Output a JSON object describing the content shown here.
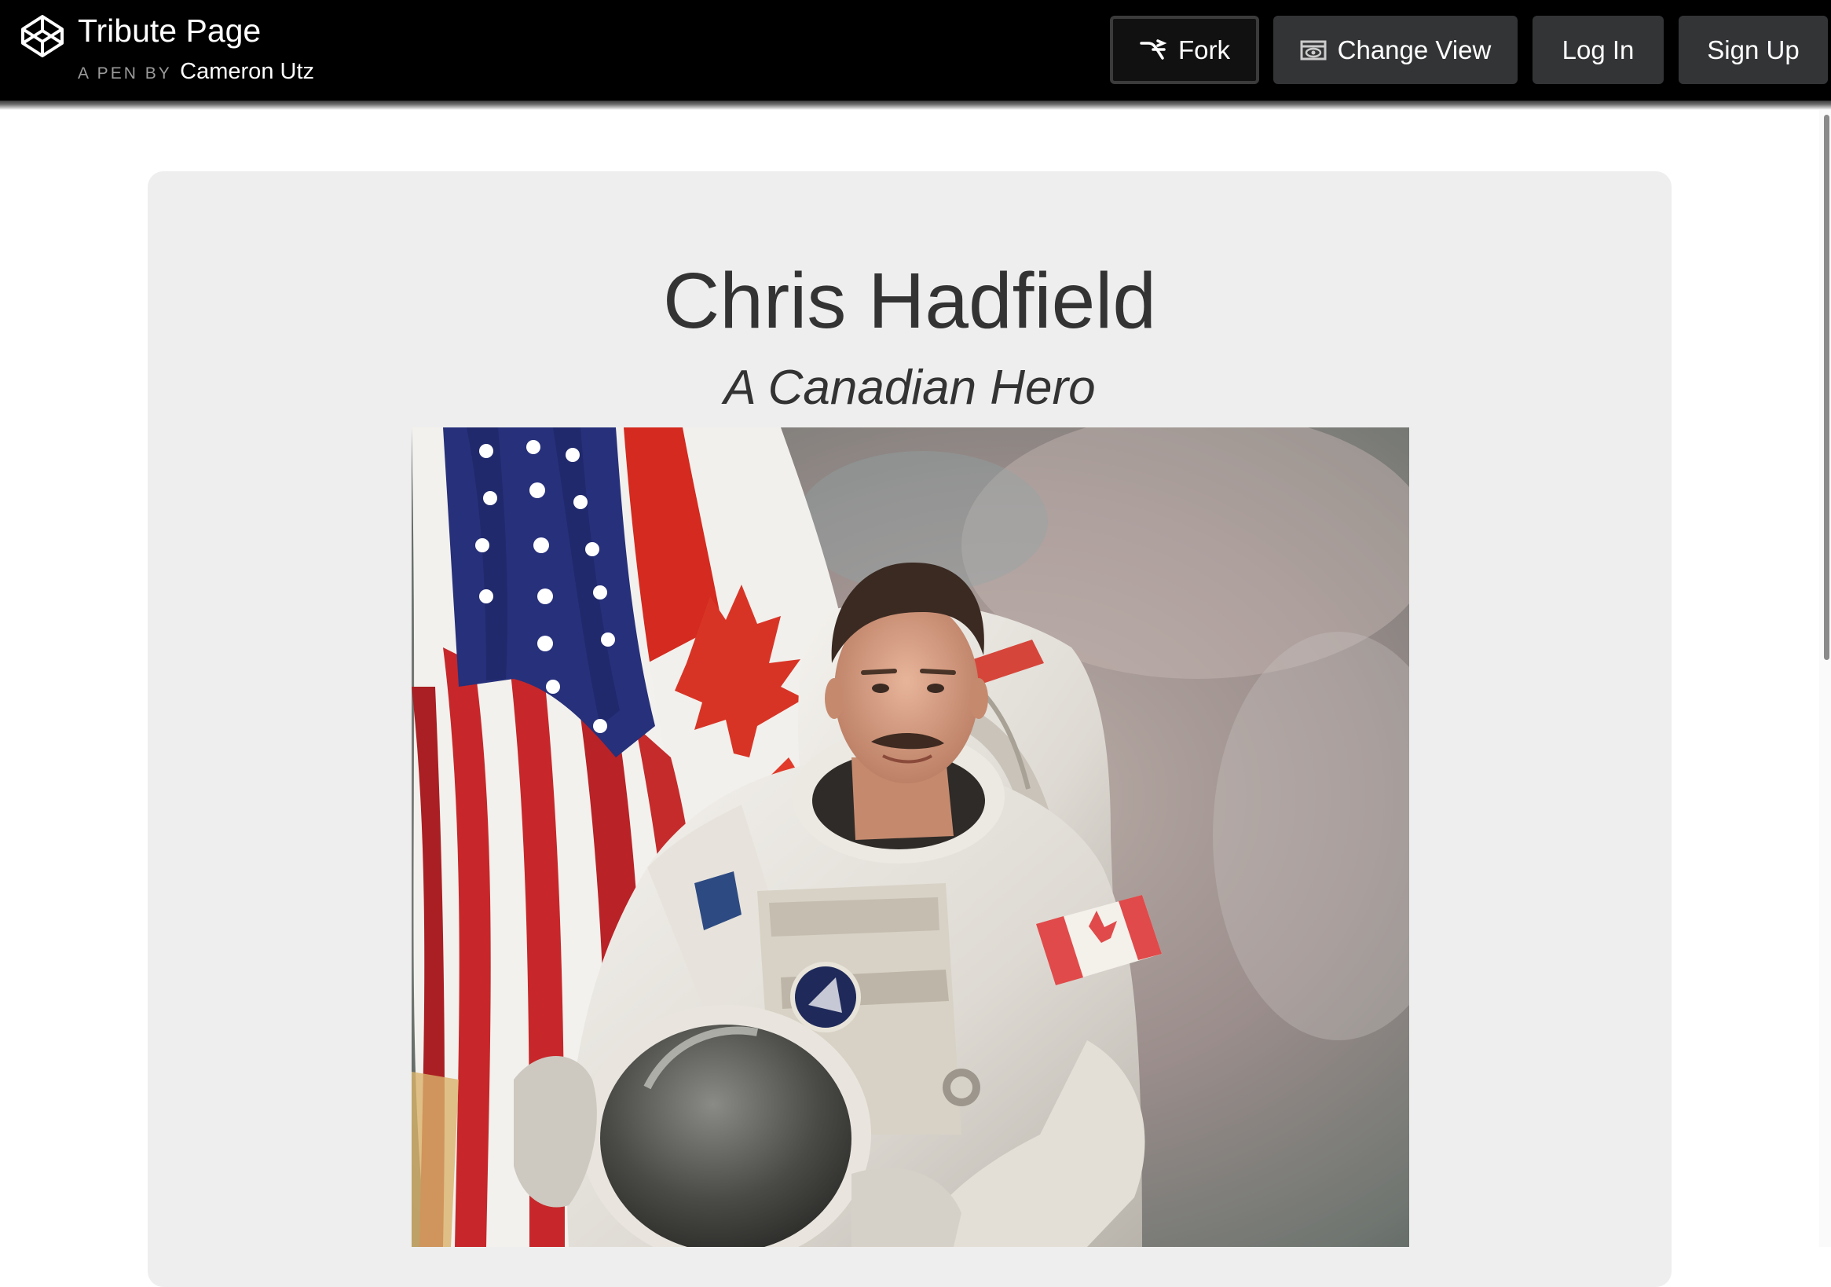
{
  "header": {
    "pen_title": "Tribute Page",
    "byline_prefix": "A PEN BY",
    "author": "Cameron Utz",
    "logo_icon": "codepen-logo-icon",
    "buttons": {
      "fork": {
        "label": "Fork",
        "icon": "fork-icon"
      },
      "change_view": {
        "label": "Change View",
        "icon": "eye-icon"
      },
      "log_in": {
        "label": "Log In"
      },
      "sign_up": {
        "label": "Sign Up"
      }
    }
  },
  "tribute": {
    "title": "Chris Hadfield",
    "subtitle": "A Canadian Hero",
    "image_subject": "astronaut portrait in spacesuit with US and Canadian flags"
  },
  "colors": {
    "topbar_bg": "#000000",
    "button_bg": "#333436",
    "panel_bg": "#eeeeee",
    "text": "#333333"
  }
}
